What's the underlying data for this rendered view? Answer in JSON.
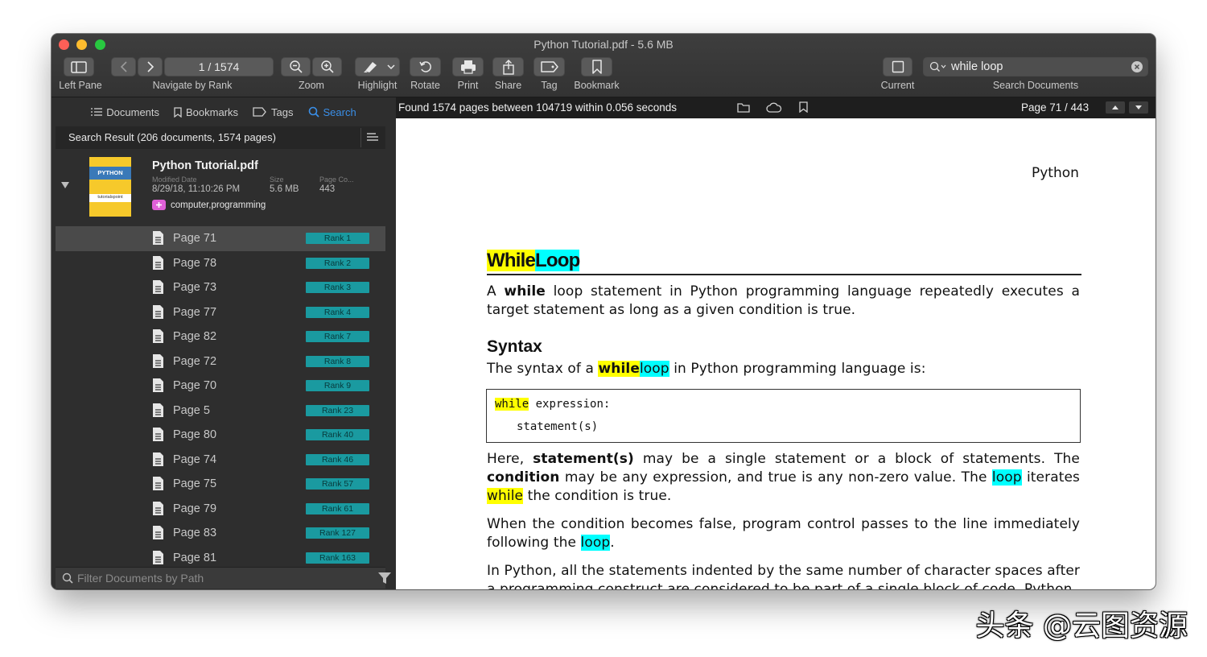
{
  "window": {
    "title": "Python Tutorial.pdf - 5.6 MB"
  },
  "toolbar": {
    "left_pane": "Left Pane",
    "page_indicator": "1 / 1574",
    "navigate": "Navigate by Rank",
    "zoom": "Zoom",
    "highlight": "Highlight",
    "rotate": "Rotate",
    "print": "Print",
    "share": "Share",
    "tag": "Tag",
    "bookmark": "Bookmark",
    "current": "Current",
    "search_value": "while loop",
    "search_documents": "Search Documents"
  },
  "sidebar": {
    "tabs": {
      "documents": "Documents",
      "bookmarks": "Bookmarks",
      "tags": "Tags",
      "search": "Search"
    },
    "result_summary": "Search Result (206 documents, 1574 pages)",
    "document": {
      "name": "Python Tutorial.pdf",
      "modified_label": "Modified Date",
      "modified_value": "8/29/18, 11:10:26 PM",
      "size_label": "Size",
      "size_value": "5.6 MB",
      "pagecount_label": "Page Co...",
      "pagecount_value": "443",
      "tags": "computer,programming",
      "thumb_title": "PYTHON",
      "thumb_brand": "tutorialspoint"
    },
    "pages": [
      {
        "label": "Page 71",
        "rank": "Rank 1"
      },
      {
        "label": "Page 78",
        "rank": "Rank 2"
      },
      {
        "label": "Page 73",
        "rank": "Rank 3"
      },
      {
        "label": "Page 77",
        "rank": "Rank 4"
      },
      {
        "label": "Page 82",
        "rank": "Rank 7"
      },
      {
        "label": "Page 72",
        "rank": "Rank 8"
      },
      {
        "label": "Page 70",
        "rank": "Rank 9"
      },
      {
        "label": "Page 5",
        "rank": "Rank 23"
      },
      {
        "label": "Page 80",
        "rank": "Rank 40"
      },
      {
        "label": "Page 74",
        "rank": "Rank 46"
      },
      {
        "label": "Page 75",
        "rank": "Rank 57"
      },
      {
        "label": "Page 79",
        "rank": "Rank 61"
      },
      {
        "label": "Page 83",
        "rank": "Rank 127"
      },
      {
        "label": "Page 81",
        "rank": "Rank 163"
      }
    ],
    "filter_placeholder": "Filter Documents by Path"
  },
  "status": {
    "found_text": "Found 1574 pages between 104719 within 0.056 seconds",
    "page_counter": "Page 71 / 443"
  },
  "document_page": {
    "header": "Python",
    "heading_while": "While",
    "heading_loop": "Loop",
    "intro_a": "A ",
    "intro_while": "while",
    "intro_rest": " loop statement in Python programming language repeatedly executes a target statement as long as a given condition is true.",
    "syntax_heading": "Syntax",
    "syntax_pre": "The syntax of a ",
    "syntax_while": "while",
    "syntax_loop": "loop",
    "syntax_post": " in Python programming language is:",
    "code_while": "while",
    "code_line1_rest": " expression:",
    "code_line2": "statement(s)",
    "here_1": "Here, ",
    "here_stmt": "statement(s)",
    "here_2": " may be a single statement or a block of statements. The ",
    "here_cond": "condition",
    "here_3": " may be any expression, and true is any non-zero value. The ",
    "here_loop": "loop",
    "here_4": " iterates ",
    "here_while": "while",
    "here_5": " the condition is true.",
    "when_1": "When the condition becomes false, program control passes to the line immediately following the ",
    "when_loop": "loop",
    "when_2": ".",
    "inpy": "In Python, all the statements indented by the same number of character spaces after a programming construct are considered to be part of a single block of code. Python"
  },
  "watermark": "头条 @云图资源",
  "colors": {
    "highlight_yellow": "#ffff00",
    "highlight_cyan": "#00ffff",
    "rank_badge": "#1a9aa0",
    "search_blue": "#3a8fe8"
  }
}
